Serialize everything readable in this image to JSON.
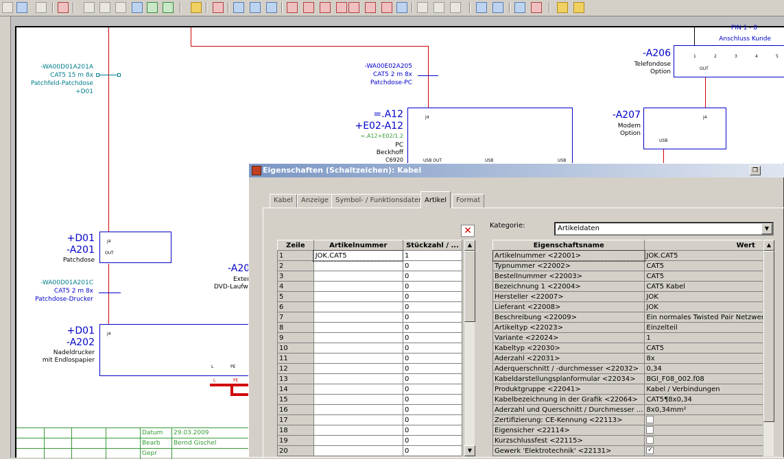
{
  "toolbar": {
    "icons": [
      "cut-icon",
      "copy-icon",
      "paste-icon",
      "undo-icon",
      "redo-icon",
      "symbol-icon",
      "cable-icon",
      "connect-icon",
      "terminal-icon",
      "wire-icon",
      "plc-icon",
      "macro-icon",
      "cross-icon",
      "grid-icon",
      "bom-icon",
      "open-icon",
      "save-icon"
    ]
  },
  "schematic": {
    "cable1": {
      "line1": "-WA00D01A201A",
      "line2": "CAT5 15 m 8x",
      "line3": "Patchfeld-Patchdose",
      "line4": "+D01"
    },
    "cable2": {
      "line1": "-WA00E02A205",
      "line2": "CAT5 2 m 8x",
      "line3": "Patchdose-PC"
    },
    "cable3": {
      "line1": "-WA00D01A201C",
      "line2": "CAT5 2 m 8x",
      "line3": "Patchdose-Drucker"
    },
    "pc": {
      "id1": "=.A12",
      "id2": "+E02-A12",
      "ref": "=.A12+E02/1.2",
      "name": "PC",
      "vendor": "Beckhoff",
      "model": "C6920",
      "j": "J4",
      "usb_out": "USB OUT",
      "usb1": "USB",
      "usb2": "USB"
    },
    "patchdose": {
      "id1": "+D01",
      "id2": "-A201",
      "name": "Patchdose",
      "j": "J4",
      "out": "OUT"
    },
    "drucker": {
      "id1": "+D01",
      "id2": "-A202",
      "name1": "Nadeldrucker",
      "name2": "mit Endlospapier",
      "j": "J4",
      "l": "L",
      "pe": "PE",
      "l2": "L",
      "pe2": "PE"
    },
    "dvd": {
      "id": "-A20",
      "l1": "Exter",
      "l2": "DVD-Laufw"
    },
    "telefon": {
      "pin": "PIN 1 - 8",
      "conn": "Anschluss Kunde",
      "id": "-A206",
      "name": "Telefondose",
      "opt": "Option",
      "out": "OUT",
      "pins": [
        "1",
        "2",
        "3",
        "4",
        "5"
      ]
    },
    "modem": {
      "id": "-A207",
      "name": "Modem",
      "opt": "Option",
      "j": "J4",
      "usb": "USB"
    },
    "titleblock": {
      "datum_label": "Datum",
      "datum": "29.03.2009",
      "bearb_label": "Bearb",
      "bearb": "Bernd Gischel",
      "gepr_label": "Gepr"
    }
  },
  "dialog": {
    "title": "Eigenschaften (Schaltzeichen): Kabel",
    "tabs": [
      "Kabel",
      "Anzeige",
      "Symbol- / Funktionsdaten",
      "Artikel",
      "Format"
    ],
    "active_tab": "Artikel",
    "left_table": {
      "headers": [
        "Zeile",
        "Artikelnummer",
        "Stückzahl / ..."
      ],
      "rows": [
        {
          "zeile": "1",
          "artikel": "JOK.CAT5",
          "stueck": "1"
        },
        {
          "zeile": "2",
          "artikel": "",
          "stueck": "0"
        },
        {
          "zeile": "3",
          "artikel": "",
          "stueck": "0"
        },
        {
          "zeile": "4",
          "artikel": "",
          "stueck": "0"
        },
        {
          "zeile": "5",
          "artikel": "",
          "stueck": "0"
        },
        {
          "zeile": "6",
          "artikel": "",
          "stueck": "0"
        },
        {
          "zeile": "7",
          "artikel": "",
          "stueck": "0"
        },
        {
          "zeile": "8",
          "artikel": "",
          "stueck": "0"
        },
        {
          "zeile": "9",
          "artikel": "",
          "stueck": "0"
        },
        {
          "zeile": "10",
          "artikel": "",
          "stueck": "0"
        },
        {
          "zeile": "11",
          "artikel": "",
          "stueck": "0"
        },
        {
          "zeile": "12",
          "artikel": "",
          "stueck": "0"
        },
        {
          "zeile": "13",
          "artikel": "",
          "stueck": "0"
        },
        {
          "zeile": "14",
          "artikel": "",
          "stueck": "0"
        },
        {
          "zeile": "15",
          "artikel": "",
          "stueck": "0"
        },
        {
          "zeile": "16",
          "artikel": "",
          "stueck": "0"
        },
        {
          "zeile": "17",
          "artikel": "",
          "stueck": "0"
        },
        {
          "zeile": "18",
          "artikel": "",
          "stueck": "0"
        },
        {
          "zeile": "19",
          "artikel": "",
          "stueck": "0"
        },
        {
          "zeile": "20",
          "artikel": "",
          "stueck": "0"
        }
      ]
    },
    "kategorie_label": "Kategorie:",
    "kategorie_value": "Artikeldaten",
    "prop_table": {
      "headers": [
        "Eigenschaftsname",
        "Wert"
      ],
      "rows": [
        {
          "name": "Artikelnummer <22001>",
          "value": "JOK.CAT5",
          "check": null
        },
        {
          "name": "Typnummer <22002>",
          "value": "CAT5",
          "check": null
        },
        {
          "name": "Bestellnummer <22003>",
          "value": "CAT5",
          "check": null
        },
        {
          "name": "Bezeichnung 1 <22004>",
          "value": "CAT5 Kabel",
          "check": null
        },
        {
          "name": "Hersteller <22007>",
          "value": "JOK",
          "check": null
        },
        {
          "name": "Lieferant <22008>",
          "value": "JOK",
          "check": null
        },
        {
          "name": "Beschreibung <22009>",
          "value": "Ein normales Twisted Pair Netzwerk,",
          "check": null
        },
        {
          "name": "Artikeltyp <22023>",
          "value": "Einzelteil",
          "check": null
        },
        {
          "name": "Variante <22024>",
          "value": "1",
          "check": null
        },
        {
          "name": "Kabeltyp <22030>",
          "value": "CAT5",
          "check": null
        },
        {
          "name": "Aderzahl <22031>",
          "value": "8x",
          "check": null
        },
        {
          "name": "Aderquerschnitt / -durchmesser <22032>",
          "value": "0,34",
          "check": null
        },
        {
          "name": "Kabeldarstellungsplanformular <22034>",
          "value": "BGI_F08_002.f08",
          "check": null
        },
        {
          "name": "Produktgruppe <22041>",
          "value": "Kabel / Verbindungen",
          "check": null
        },
        {
          "name": "Kabelbezeichnung in der Grafik <22064>",
          "value": "CAT5¶8x0,34",
          "check": null
        },
        {
          "name": "Aderzahl und Querschnitt / Durchmesser ...",
          "value": "8x0,34mm²",
          "check": null
        },
        {
          "name": "Zertifizierung: CE-Kennung <22113>",
          "value": "",
          "check": false
        },
        {
          "name": "Eigensicher <22114>",
          "value": "",
          "check": false
        },
        {
          "name": "Kurzschlussfest <22115>",
          "value": "",
          "check": false
        },
        {
          "name": "Gewerk 'Elektrotechnik' <22131>",
          "value": "",
          "check": true
        }
      ]
    },
    "delete_icon": "delete-icon"
  }
}
